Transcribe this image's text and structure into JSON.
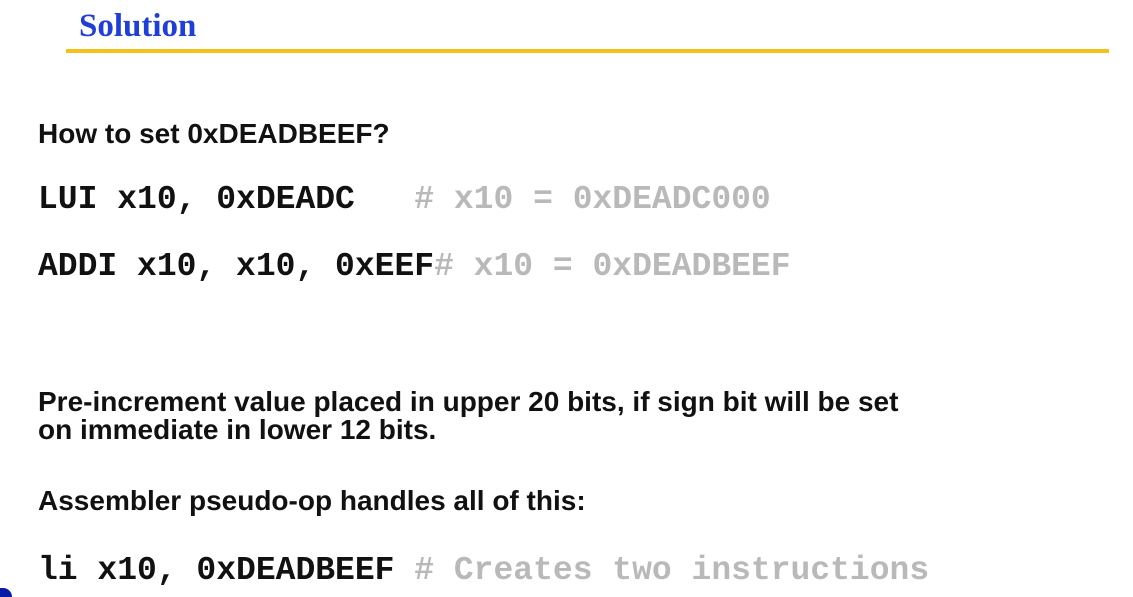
{
  "slide": {
    "title": "Solution",
    "question": "How to set 0xDEADBEEF?",
    "code": [
      {
        "instr": "LUI x10, 0xDEADC   ",
        "comment": "# x10 = 0xDEADC000"
      },
      {
        "instr": "ADDI x10, x10, 0xEEF",
        "comment": "# x10 = 0xDEADBEEF"
      }
    ],
    "paragraph_line1": "Pre-increment value placed in upper 20 bits, if sign bit will be set",
    "paragraph_line2": "on immediate in lower 12 bits.",
    "pseudo_op_text": "Assembler pseudo-op handles all of this:",
    "pseudo_code": {
      "instr": "li x10, 0xDEADBEEF ",
      "comment": "# Creates two instructions"
    }
  },
  "colors": {
    "title": "#1f3fd6",
    "title_rule": "#f5c21a",
    "comment": "#b9b9b9",
    "text": "#111111"
  }
}
